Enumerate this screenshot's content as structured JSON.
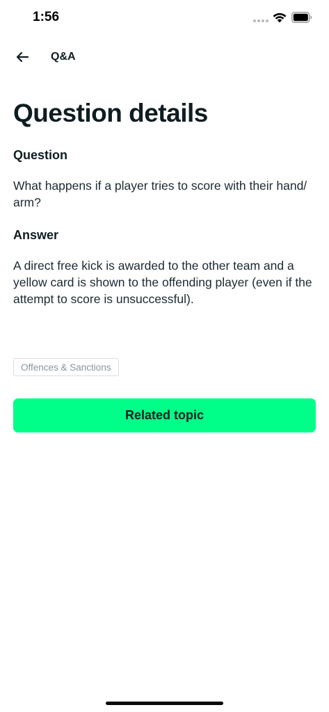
{
  "status_bar": {
    "time": "1:56"
  },
  "nav": {
    "back_icon": "arrow-left-icon",
    "title": "Q&A"
  },
  "page": {
    "title": "Question details"
  },
  "question": {
    "label": "Question",
    "text": "What happens if a player tries to score with their hand/ arm?"
  },
  "answer": {
    "label": "Answer",
    "text": "A direct free kick is awarded to the other team and a yellow card is shown to the offending player (even if the attempt to score is unsuccessful)."
  },
  "tag": {
    "label": "Offences & Sanctions"
  },
  "actions": {
    "related_label": "Related topic"
  },
  "colors": {
    "accent": "#00ff88",
    "text": "#0f1d22",
    "tag_text": "#8a959b",
    "tag_border": "#d9dde0"
  }
}
